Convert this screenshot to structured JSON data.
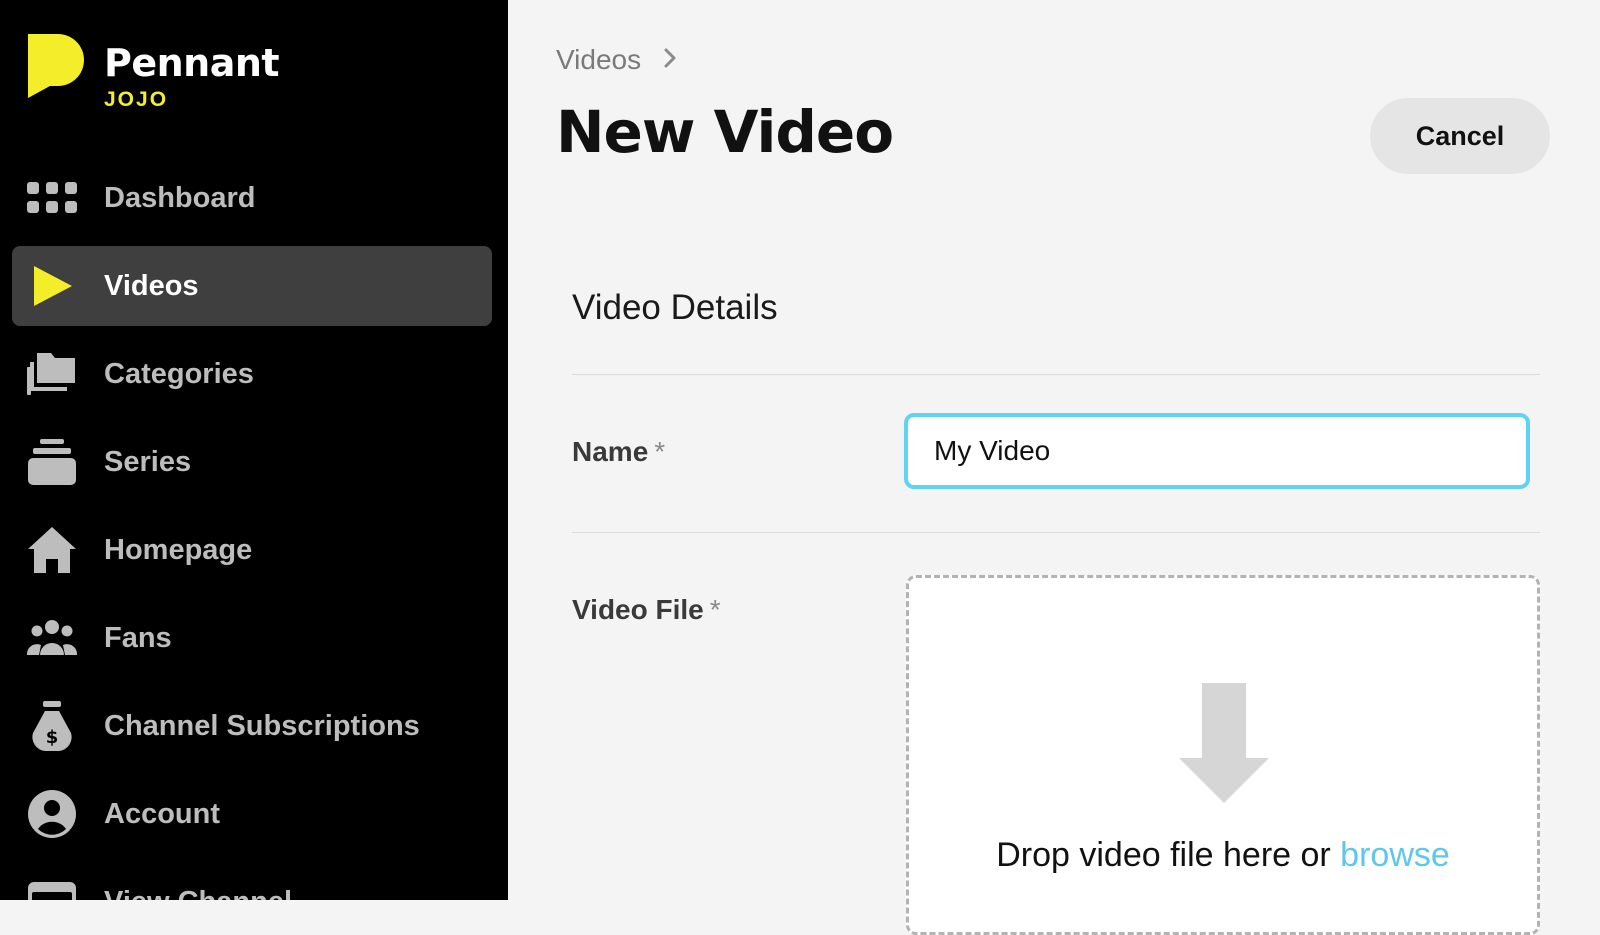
{
  "sidebar": {
    "brand": "Pennant",
    "workspace": "JOJO",
    "items": [
      {
        "label": "Dashboard",
        "icon": "grid-icon",
        "active": false
      },
      {
        "label": "Videos",
        "icon": "play-icon",
        "active": true
      },
      {
        "label": "Categories",
        "icon": "folders-icon",
        "active": false
      },
      {
        "label": "Series",
        "icon": "stack-icon",
        "active": false
      },
      {
        "label": "Homepage",
        "icon": "home-icon",
        "active": false
      },
      {
        "label": "Fans",
        "icon": "users-icon",
        "active": false
      },
      {
        "label": "Channel Subscriptions",
        "icon": "money-bag-icon",
        "active": false
      },
      {
        "label": "Account",
        "icon": "account-icon",
        "active": false
      },
      {
        "label": "View Channel",
        "icon": "browser-icon",
        "active": false
      }
    ]
  },
  "breadcrumb": {
    "parent": "Videos"
  },
  "page": {
    "title": "New Video",
    "cancel_label": "Cancel"
  },
  "form": {
    "section_title": "Video Details",
    "name_label": "Name",
    "required_marker": "*",
    "name_value": "My Video",
    "file_label": "Video File",
    "drop_text": "Drop video file here or ",
    "browse_label": "browse"
  },
  "colors": {
    "accent_yellow": "#f4ee2a",
    "focus_blue": "#5fd3f3",
    "link_blue": "#5fc6ee",
    "sidebar_bg": "#000000",
    "active_item_bg": "#3f3f3f"
  }
}
